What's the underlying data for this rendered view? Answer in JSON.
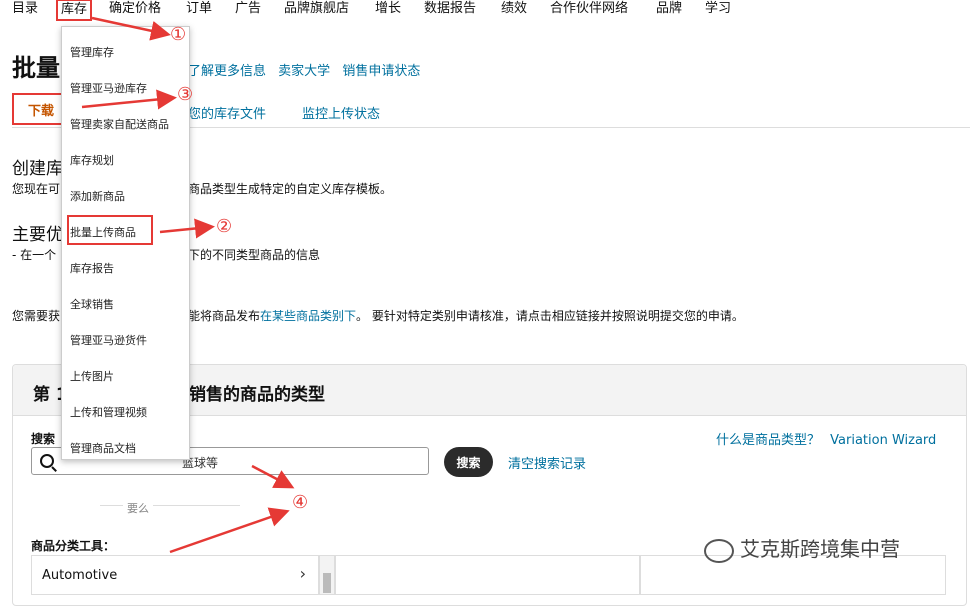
{
  "topnav": [
    "目录",
    "库存",
    "确定价格",
    "订单",
    "广告",
    "品牌旗舰店",
    "增长",
    "数据报告",
    "绩效",
    "合作伙伴网络",
    "品牌",
    "学习"
  ],
  "page": {
    "title": "批量",
    "links": [
      "了解更多信息",
      "卖家大学",
      "销售申请状态"
    ],
    "tabs": {
      "download": "下载",
      "inventory_file": "您的库存文件",
      "monitor": "监控上传状态"
    }
  },
  "content": {
    "section1_title": "创建库",
    "section1_text_a": "您现在可",
    "section1_text_b": "商品类型生成特定的自定义库存模板。",
    "section2_title": "主要优",
    "section2_text_a": "- 在一个",
    "section2_text_b": "下的不同类型商品的信息",
    "notice_a": "您需要获",
    "notice_b": "能将商品发布",
    "notice_link": "在某些商品类别下",
    "notice_c": "。 要针对特定类别申请核准，请点击相应链接并按照说明提交您的申请。"
  },
  "card": {
    "title_a": "第 1",
    "title_b": "销售的商品的类型",
    "search_label": "搜索",
    "search_placeholder": "篮球等",
    "search_button": "搜索",
    "clear_history": "清空搜索记录",
    "what_is_type": "什么是商品类型？",
    "variation_wizard": "Variation Wizard",
    "or_text": "要么",
    "tool_label": "商品分类工具：",
    "first_category": "Automotive"
  },
  "dropdown": [
    "管理库存",
    "管理亚马逊库存",
    "管理卖家自配送商品",
    "库存规划",
    "添加新商品",
    "批量上传商品",
    "库存报告",
    "全球销售",
    "管理亚马逊货件",
    "上传图片",
    "上传和管理视频",
    "管理商品文档"
  ],
  "annotations": {
    "one": "①",
    "two": "②",
    "three": "③",
    "four": "④"
  },
  "watermark": "艾克斯跨境集中营",
  "colors": {
    "annotation_red": "#e53935",
    "link": "#00709e",
    "accent_orange": "#c45500"
  }
}
